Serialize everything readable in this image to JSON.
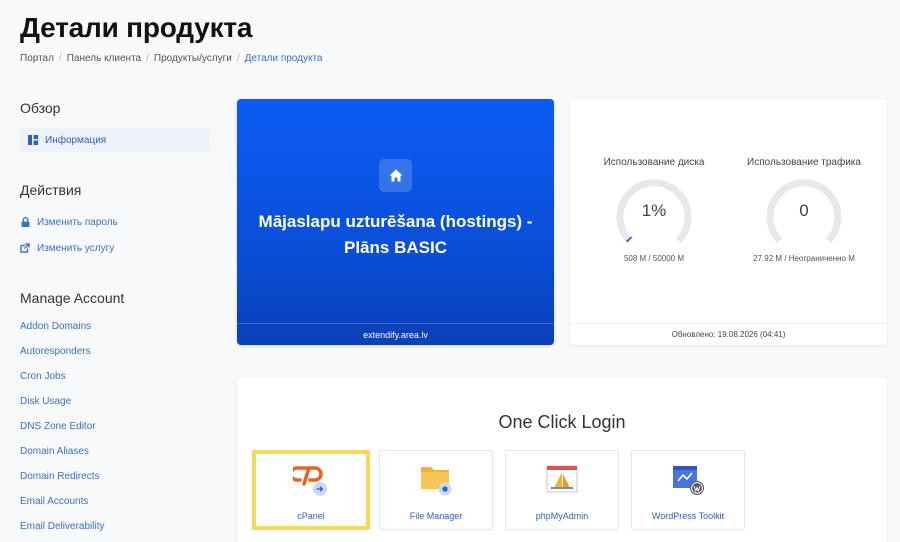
{
  "page": {
    "title": "Детали продукта",
    "breadcrumb": [
      "Портал",
      "Панель клиента",
      "Продукты/услуги",
      "Детали продукта"
    ]
  },
  "sidebar": {
    "overview_heading": "Обзор",
    "overview_items": [
      {
        "label": "Информация"
      }
    ],
    "actions_heading": "Действия",
    "actions_items": [
      {
        "label": "Изменить пароль"
      },
      {
        "label": "Изменить услугу"
      }
    ],
    "manage_heading": "Manage Account",
    "manage_items": [
      "Addon Domains",
      "Autoresponders",
      "Cron Jobs",
      "Disk Usage",
      "DNS Zone Editor",
      "Domain Aliases",
      "Domain Redirects",
      "Email Accounts",
      "Email Deliverability"
    ]
  },
  "product": {
    "name": "Mājaslapu uzturēšana (hostings) - Plāns BASIC",
    "domain": "extendify.area.lv"
  },
  "usage": {
    "disk": {
      "title": "Использование диска",
      "value": "1%",
      "percent": 1,
      "detail": "508 M / 50000 M"
    },
    "traffic": {
      "title": "Использование трафика",
      "value": "0",
      "percent": 0,
      "detail": "27.92 M / Неограниченно M"
    },
    "updated": "Обновлено: 19.08.2026 (04:41)"
  },
  "one_click": {
    "title": "One Click Login",
    "tiles": [
      {
        "label": "cPanel",
        "icon": "cpanel-icon"
      },
      {
        "label": "File Manager",
        "icon": "file-manager-icon"
      },
      {
        "label": "phpMyAdmin",
        "icon": "phpmyadmin-icon"
      },
      {
        "label": "WordPress Toolkit",
        "icon": "wordpress-toolkit-icon"
      }
    ]
  },
  "colors": {
    "accent": "#3a6fd8",
    "product_card": "#0b5cf3",
    "highlight": "#f5d85a",
    "gauge_fill": "#3a6fd8",
    "gauge_track": "#e6e8eb"
  }
}
